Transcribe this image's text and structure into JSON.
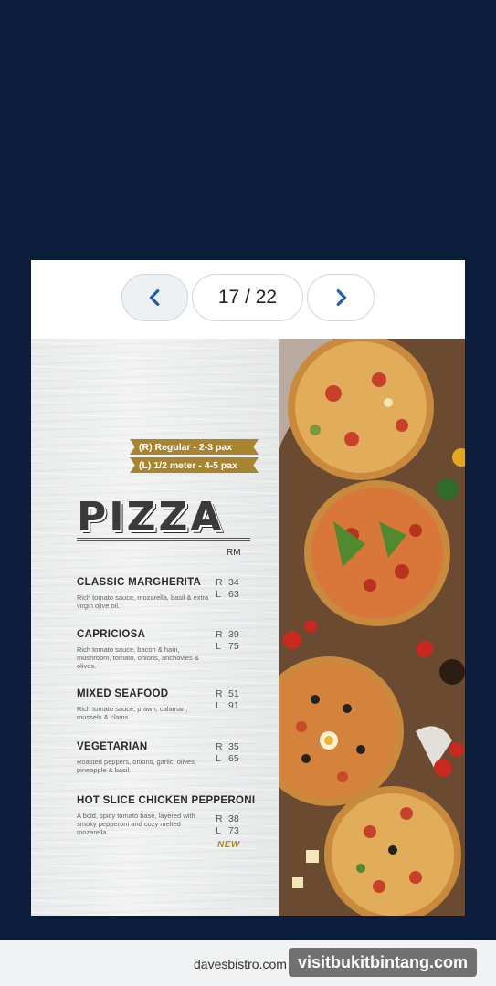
{
  "pager": {
    "current": "17 / 22"
  },
  "menu": {
    "size_tags": [
      "(R) Regular  - 2-3 pax",
      "(L) 1/2 meter  - 4-5 pax"
    ],
    "title": "PIZZA",
    "currency": "RM",
    "items": [
      {
        "name": "CLASSIC MARGHERITA",
        "desc": "Rich tomato sauce, mozarella, basil & extra virgin olive oil.",
        "r": "34",
        "l": "63"
      },
      {
        "name": "CAPRICIOSA",
        "desc": "Rich tomato sauce, bacon & ham, mushroom, tomato, onions, anchovies & olives.",
        "r": "39",
        "l": "75"
      },
      {
        "name": "MIXED SEAFOOD",
        "desc": "Rich tomato sauce, prawn, calamari, mussels & clams.",
        "r": "51",
        "l": "91"
      },
      {
        "name": "VEGETARIAN",
        "desc": "Roasted peppers, onions, garlic, olives, pineapple & basil.",
        "r": "35",
        "l": "65"
      },
      {
        "name": "HOT SLICE CHICKEN PEPPERONI",
        "desc": "A bold, spicy tomato base, layered with smoky pepperoni and cozy melted mozarella.",
        "r": "38",
        "l": "73"
      }
    ],
    "price_labels": {
      "r": "R",
      "l": "L"
    },
    "new_label": "NEW"
  },
  "footer": {
    "domain": "davesbistro.com",
    "watermark": "visitbukitbintang.com"
  },
  "colors": {
    "background": "#0b1f3d",
    "accent_gold": "#a8842e",
    "arrow": "#1d5fa8"
  },
  "icons": {
    "prev": "chevron-left-icon",
    "next": "chevron-right-icon"
  }
}
